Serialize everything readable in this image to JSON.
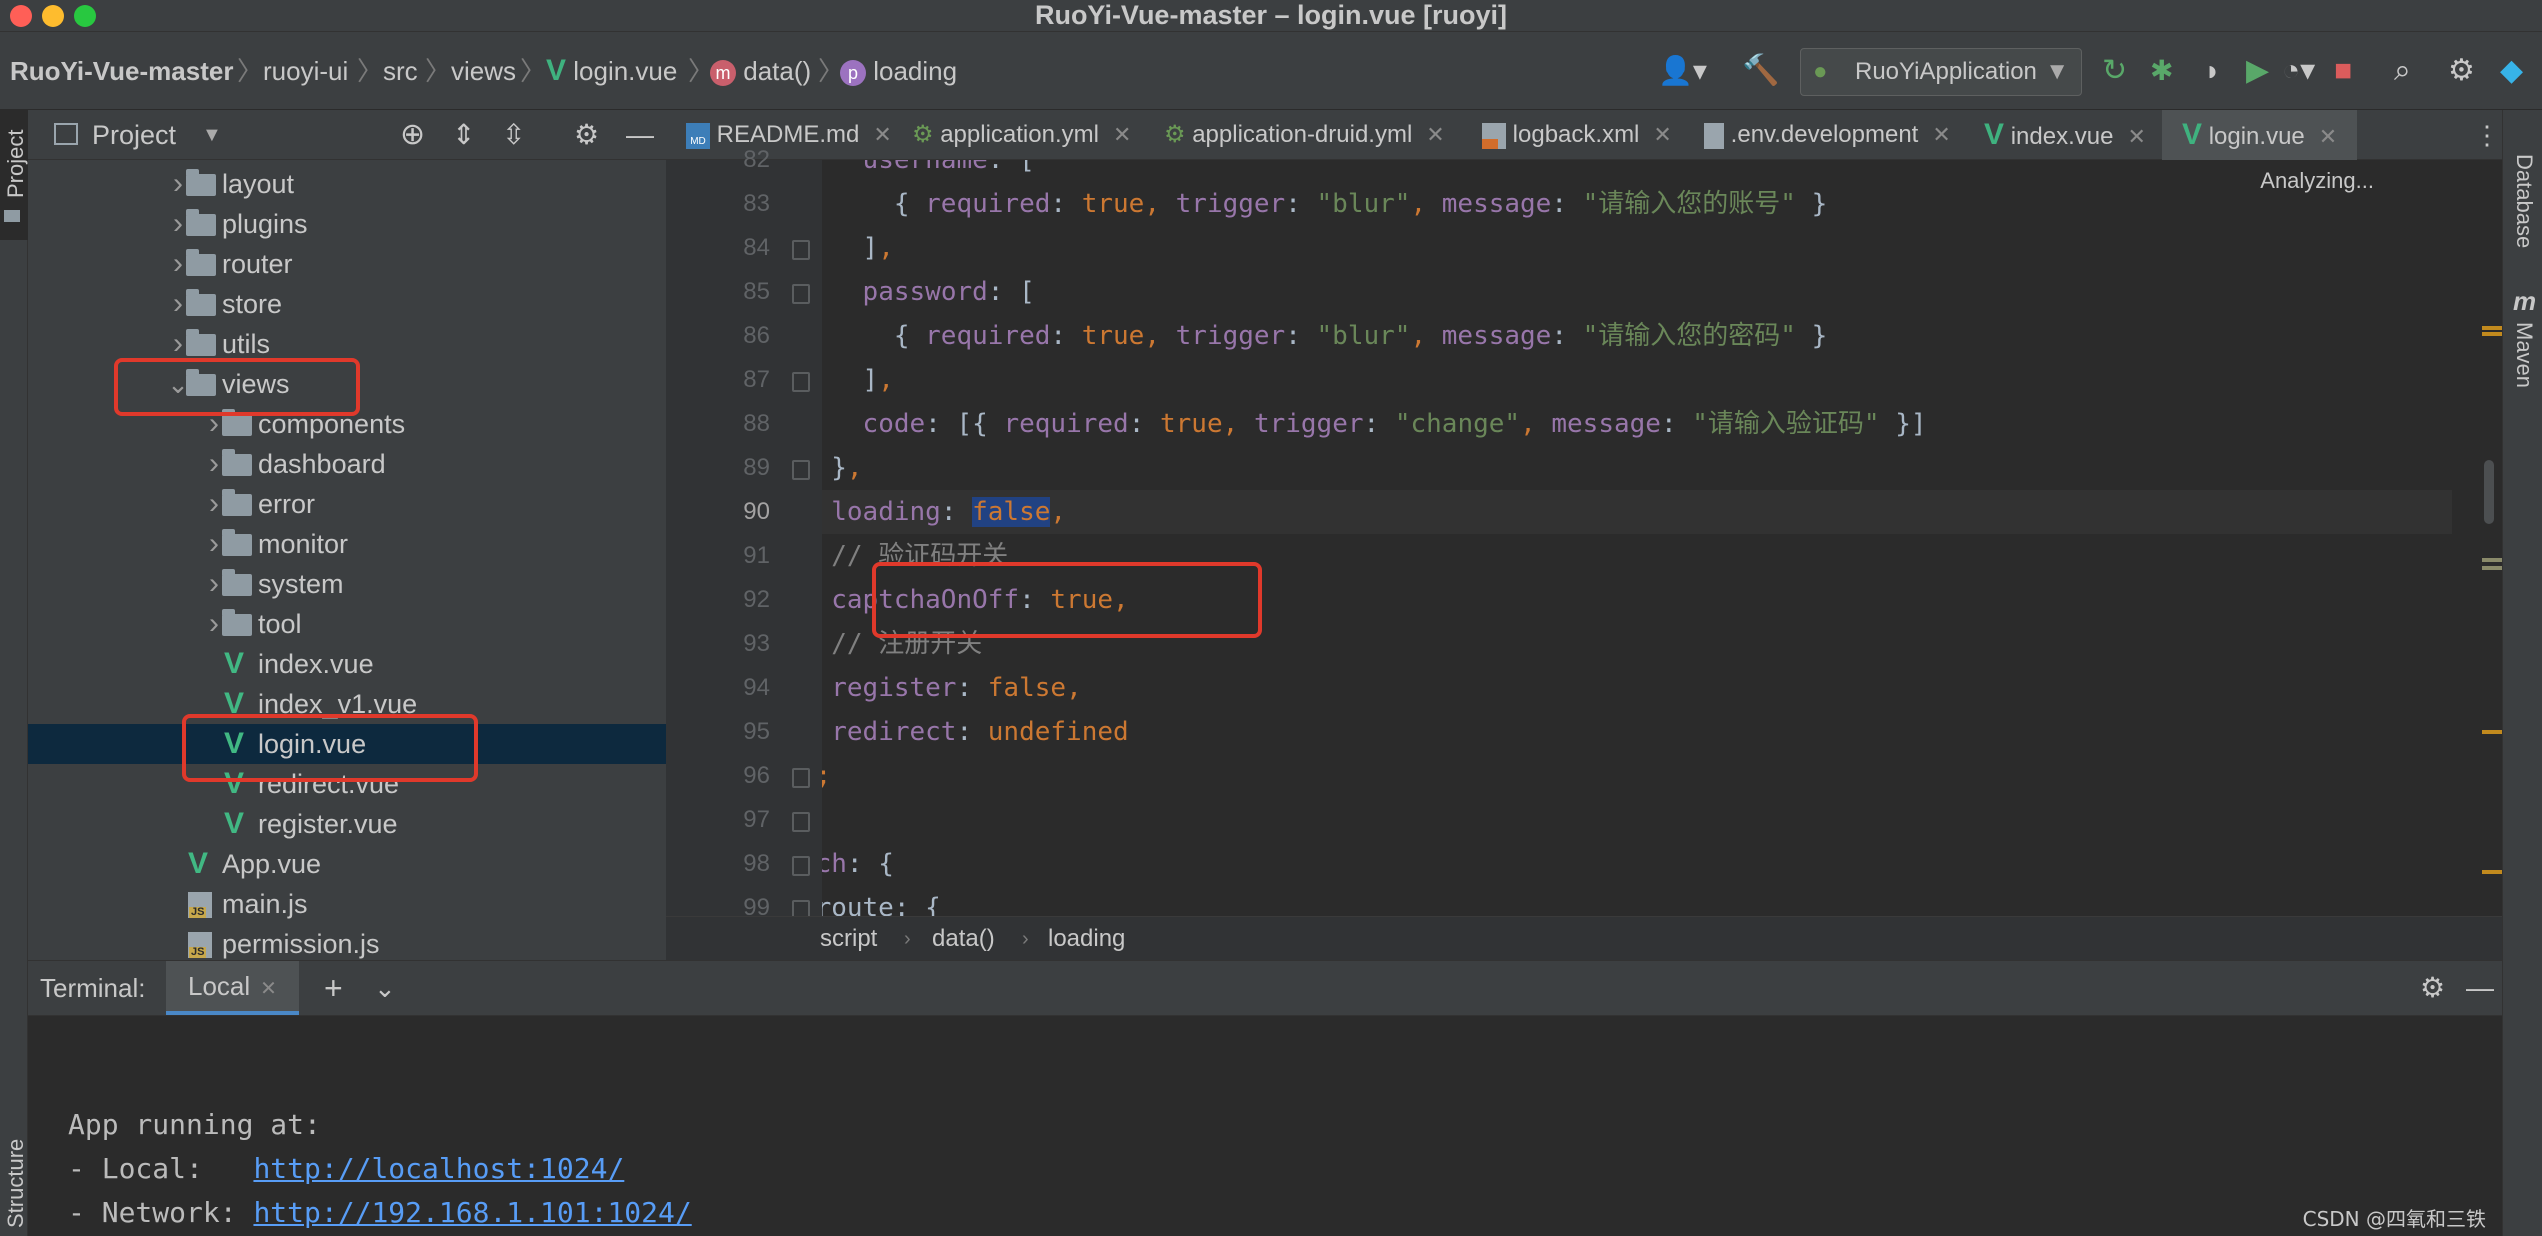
{
  "window": {
    "title": "RuoYi-Vue-master – login.vue [ruoyi]"
  },
  "navbar": {
    "breadcrumb": [
      "RuoYi-Vue-master",
      "ruoyi-ui",
      "src",
      "views",
      "login.vue",
      "data()",
      "loading"
    ],
    "method_badge": "m",
    "property_badge": "p",
    "run_config": "RuoYiApplication"
  },
  "left_stripe": {
    "project": "Project",
    "structure": "Structure"
  },
  "right_stripe": {
    "database": "Database",
    "maven": "Maven",
    "maven_icon": "m"
  },
  "project_panel": {
    "title": "Project",
    "tree": [
      {
        "label": "layout",
        "type": "folder",
        "depth": 1,
        "expanded": false
      },
      {
        "label": "plugins",
        "type": "folder",
        "depth": 1,
        "expanded": false
      },
      {
        "label": "router",
        "type": "folder",
        "depth": 1,
        "expanded": false
      },
      {
        "label": "store",
        "type": "folder",
        "depth": 1,
        "expanded": false
      },
      {
        "label": "utils",
        "type": "folder",
        "depth": 1,
        "expanded": false
      },
      {
        "label": "views",
        "type": "folder",
        "depth": 1,
        "expanded": true
      },
      {
        "label": "components",
        "type": "folder",
        "depth": 2,
        "expanded": false
      },
      {
        "label": "dashboard",
        "type": "folder",
        "depth": 2,
        "expanded": false
      },
      {
        "label": "error",
        "type": "folder",
        "depth": 2,
        "expanded": false
      },
      {
        "label": "monitor",
        "type": "folder",
        "depth": 2,
        "expanded": false
      },
      {
        "label": "system",
        "type": "folder",
        "depth": 2,
        "expanded": false
      },
      {
        "label": "tool",
        "type": "folder",
        "depth": 2,
        "expanded": false
      },
      {
        "label": "index.vue",
        "type": "vue",
        "depth": 2
      },
      {
        "label": "index_v1.vue",
        "type": "vue",
        "depth": 2
      },
      {
        "label": "login.vue",
        "type": "vue",
        "depth": 2,
        "selected": true
      },
      {
        "label": "redirect.vue",
        "type": "vue",
        "depth": 2
      },
      {
        "label": "register.vue",
        "type": "vue",
        "depth": 2
      },
      {
        "label": "App.vue",
        "type": "vue",
        "depth": 1
      },
      {
        "label": "main.js",
        "type": "js",
        "depth": 1
      },
      {
        "label": "permission.js",
        "type": "js",
        "depth": 1
      }
    ]
  },
  "tabs": [
    {
      "label": "README.md",
      "icon": "MD"
    },
    {
      "label": "application.yml",
      "icon": "yml"
    },
    {
      "label": "application-druid.yml",
      "icon": "yml"
    },
    {
      "label": "logback.xml",
      "icon": "xml"
    },
    {
      "label": ".env.development",
      "icon": "txt"
    },
    {
      "label": "index.vue",
      "icon": "vue"
    },
    {
      "label": "login.vue",
      "icon": "vue",
      "active": true
    }
  ],
  "editor": {
    "status": "Analyzing...",
    "current_line": 90,
    "lines": [
      {
        "n": 82,
        "text": "          username: ["
      },
      {
        "n": 83,
        "text": "            { required: true, trigger: \"blur\", message: \"请输入您的账号\" }"
      },
      {
        "n": 84,
        "text": "          ],"
      },
      {
        "n": 85,
        "text": "          password: ["
      },
      {
        "n": 86,
        "text": "            { required: true, trigger: \"blur\", message: \"请输入您的密码\" }"
      },
      {
        "n": 87,
        "text": "          ],"
      },
      {
        "n": 88,
        "text": "          code: [{ required: true, trigger: \"change\", message: \"请输入验证码\" }]"
      },
      {
        "n": 89,
        "text": "        },"
      },
      {
        "n": 90,
        "text": "        loading: false,"
      },
      {
        "n": 91,
        "text": "        // 验证码开关"
      },
      {
        "n": 92,
        "text": "        captchaOnOff: true,"
      },
      {
        "n": 93,
        "text": "        // 注册开关"
      },
      {
        "n": 94,
        "text": "        register: false,"
      },
      {
        "n": 95,
        "text": "        redirect: undefined"
      },
      {
        "n": 96,
        "text": "      };"
      },
      {
        "n": 97,
        "text": "    },"
      },
      {
        "n": 98,
        "text": "    watch: {"
      },
      {
        "n": 99,
        "text": "      $route: {"
      }
    ],
    "breadcrumb": [
      "script",
      "data()",
      "loading"
    ]
  },
  "terminal": {
    "label": "Terminal:",
    "tab": "Local",
    "lines": [
      {
        "text": "App running at:"
      },
      {
        "prefix": "- Local:   ",
        "link": "http://localhost:1024/"
      },
      {
        "prefix": "- Network: ",
        "link": "http://192.168.1.101:1024/"
      }
    ]
  },
  "watermark": "CSDN @四氧和三铁",
  "colors": {
    "accent": "#4a88c7",
    "annotation": "#e0392b",
    "selection": "#0d293e"
  }
}
